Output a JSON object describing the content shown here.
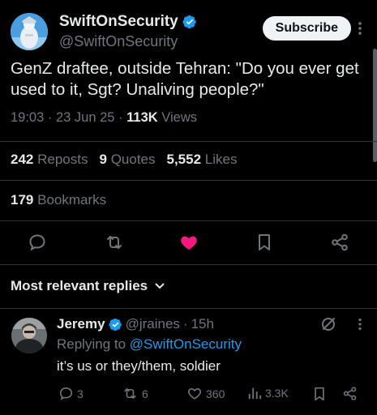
{
  "tweet": {
    "author_name": "SwiftOnSecurity",
    "author_handle": "@SwiftOnSecurity",
    "subscribe_label": "Subscribe",
    "text": "GenZ draftee, outside Tehran: \"Do you ever get used to it, Sgt? Unaliving people?\"",
    "time": "19:03",
    "date": "23 Jun 25",
    "views_count": "113K",
    "views_label": "Views",
    "reposts_count": "242",
    "reposts_label": "Reposts",
    "quotes_count": "9",
    "quotes_label": "Quotes",
    "likes_count": "5,552",
    "likes_label": "Likes",
    "bookmarks_count": "179",
    "bookmarks_label": "Bookmarks",
    "liked": true
  },
  "replies_section": {
    "sort_label": "Most relevant replies"
  },
  "reply": {
    "author_name": "Jeremy",
    "author_handle": "@jraines",
    "age": "15h",
    "replying_prefix": "Replying to",
    "replying_to": "@SwiftOnSecurity",
    "text": "it’s us or they/them, soldier",
    "replies": "3",
    "reposts": "6",
    "likes": "360",
    "views": "3.3K"
  },
  "colors": {
    "background": "#000000",
    "text": "#e7e9ea",
    "muted": "#71767b",
    "link": "#1d9bf0",
    "like": "#f91880",
    "verified": "#1d9bf0"
  },
  "icons": {
    "verified": "verified-badge-icon",
    "more": "more-dots-icon",
    "reply": "reply-bubble-icon",
    "repost": "repost-icon",
    "like": "heart-icon",
    "bookmark": "bookmark-icon",
    "share": "share-icon",
    "chevron": "chevron-down-icon",
    "grok": "grok-icon",
    "views": "views-bars-icon"
  }
}
